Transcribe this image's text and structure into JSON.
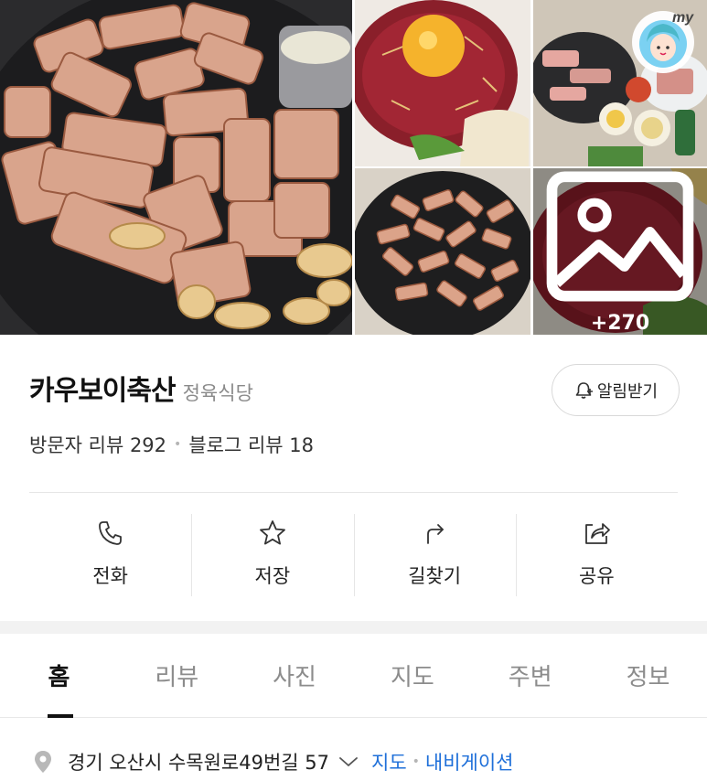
{
  "gallery": {
    "more_count": "+270",
    "badge_text": "my"
  },
  "place": {
    "name": "카우보이축산",
    "category": "정육식당",
    "alarm_label": "알림받기"
  },
  "reviews": {
    "visitor": "방문자 리뷰 292",
    "blog": "블로그 리뷰 18",
    "separator": "•"
  },
  "actions": [
    {
      "label": "전화",
      "icon": "phone-icon"
    },
    {
      "label": "저장",
      "icon": "star-icon"
    },
    {
      "label": "길찾기",
      "icon": "directions-icon"
    },
    {
      "label": "공유",
      "icon": "share-icon"
    }
  ],
  "tabs": [
    {
      "label": "홈",
      "active": true
    },
    {
      "label": "리뷰",
      "active": false
    },
    {
      "label": "사진",
      "active": false
    },
    {
      "label": "지도",
      "active": false
    },
    {
      "label": "주변",
      "active": false
    },
    {
      "label": "정보",
      "active": false
    }
  ],
  "address": {
    "text": "경기 오산시 수목원로49번길 57",
    "map_link": "지도",
    "nav_link": "내비게이션",
    "separator": "•"
  },
  "colors": {
    "link": "#1e6fd9",
    "text": "#222222",
    "muted": "#8a8a8a"
  }
}
